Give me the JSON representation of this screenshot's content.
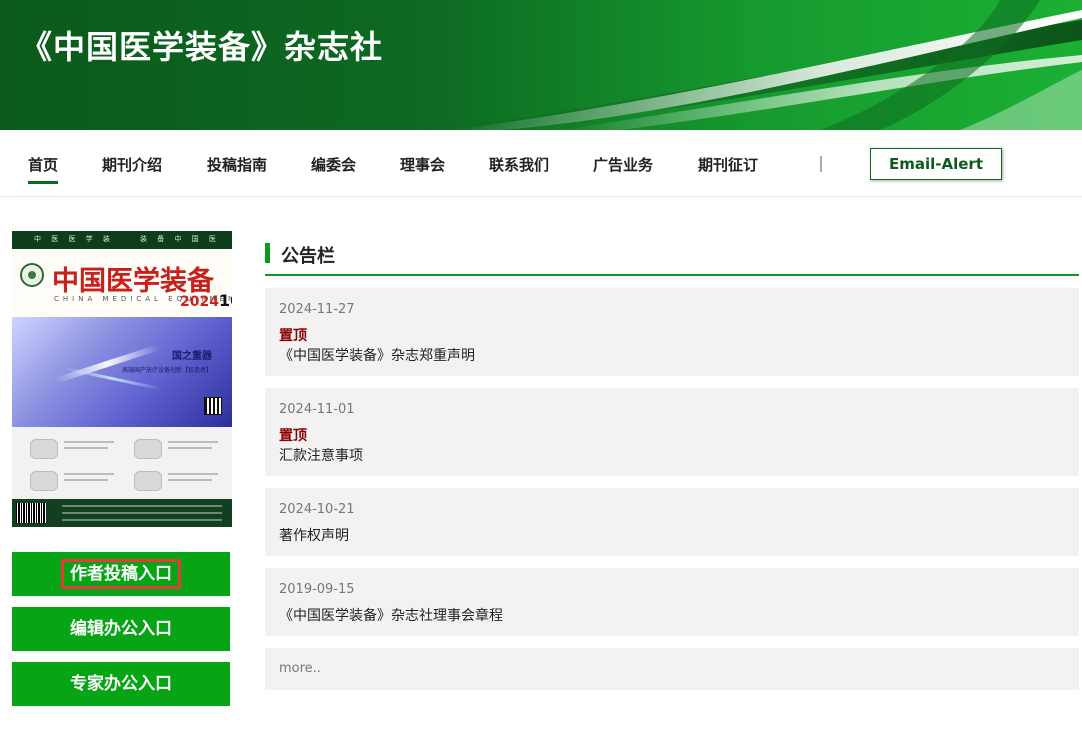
{
  "site": {
    "title": "《中国医学装备》杂志社",
    "accent": "#0b6b22",
    "button_green": "#07a516"
  },
  "nav": {
    "items": [
      {
        "label": "首页",
        "active": true
      },
      {
        "label": "期刊介绍"
      },
      {
        "label": "投稿指南"
      },
      {
        "label": "编委会"
      },
      {
        "label": "理事会"
      },
      {
        "label": "联系我们"
      },
      {
        "label": "广告业务"
      },
      {
        "label": "期刊征订"
      }
    ],
    "divider": "|",
    "email_alert": "Email-Alert"
  },
  "cover": {
    "strip_left": "中 医 医 学 装",
    "strip_right": "装 备 中 国 医",
    "name": "中国医学装备",
    "english": "CHINA MEDICAL EQUIPMENT",
    "year": "2024",
    "issue": "10",
    "ad_title": "国之重器",
    "ad_subtitle": "高端国产放疗设备创新【智造者】"
  },
  "entries": {
    "author": "作者投稿入口",
    "editor": "编辑办公入口",
    "expert": "专家办公入口"
  },
  "notices": {
    "heading": "公告栏",
    "items": [
      {
        "date": "2024-11-27",
        "pin": "置顶",
        "title": "《中国医学装备》杂志郑重声明"
      },
      {
        "date": "2024-11-01",
        "pin": "置顶",
        "title": "汇款注意事项"
      },
      {
        "date": "2024-10-21",
        "title": "著作权声明"
      },
      {
        "date": "2019-09-15",
        "title": "《中国医学装备》杂志社理事会章程"
      }
    ],
    "more": "more.."
  }
}
